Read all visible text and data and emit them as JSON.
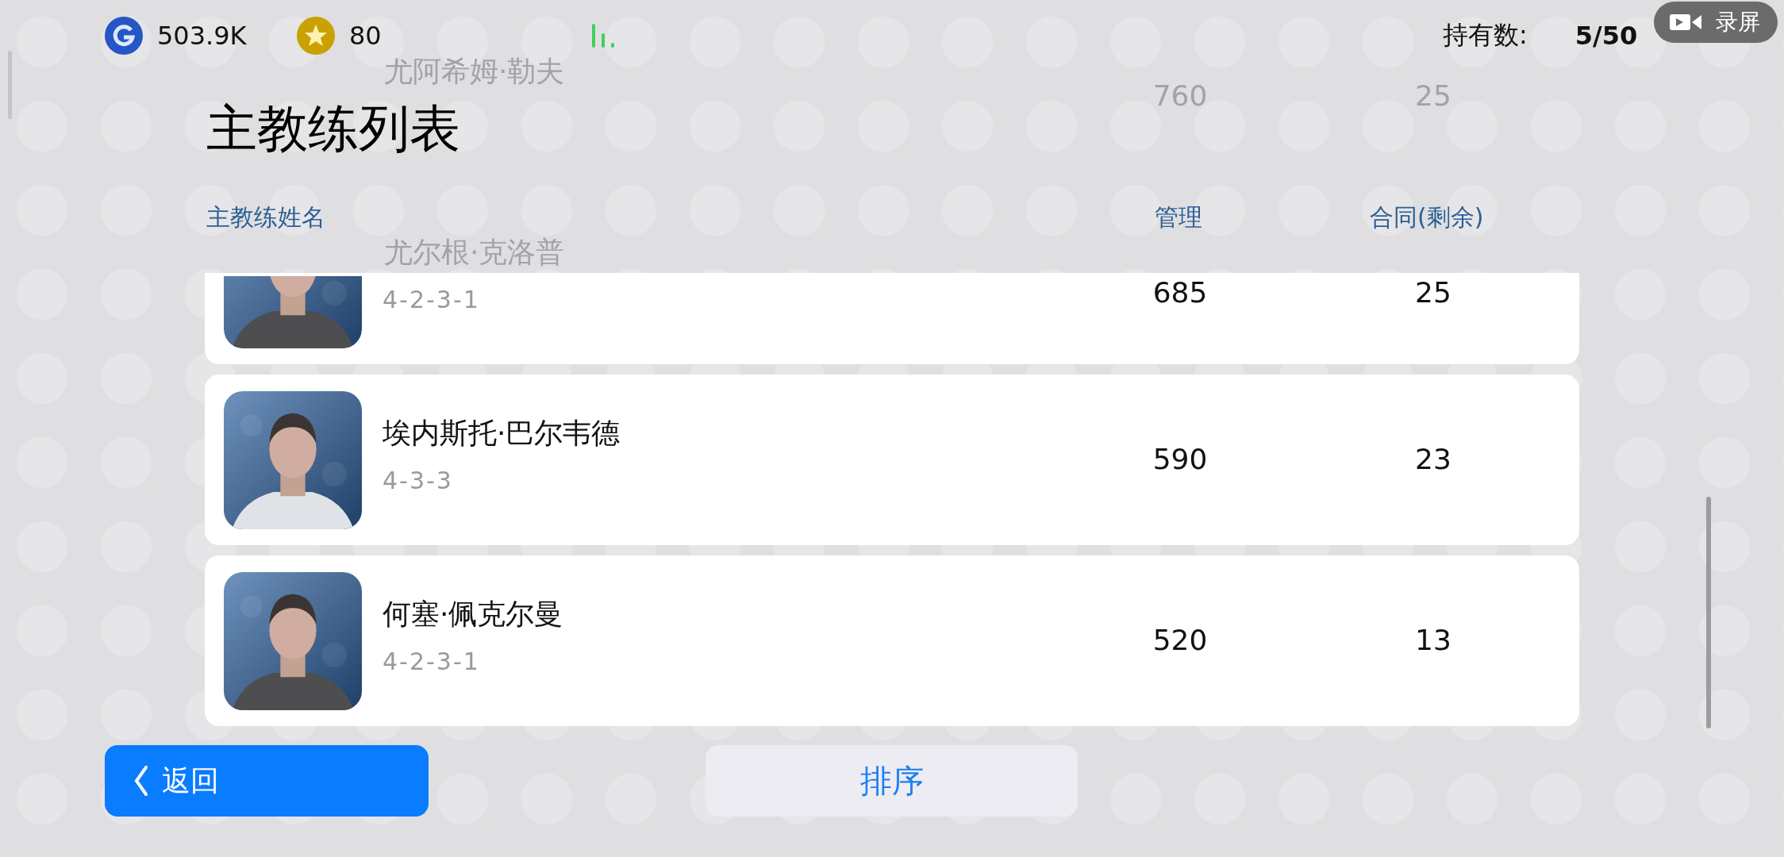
{
  "top_bar": {
    "coins": "503.9K",
    "stars": "80",
    "owned_label": "持有数:",
    "owned_value": "5/50"
  },
  "recorder": {
    "label": "录屏"
  },
  "title": "主教练列表",
  "columns": [
    "主教练姓名",
    "管理",
    "合同(剩余)"
  ],
  "coaches": [
    {
      "name": "尤阿希姆·勒夫",
      "management": "760",
      "contract": "25",
      "under_header": true,
      "top_cut": false
    },
    {
      "name": "尤尔根·克洛普",
      "formation": "4-2-3-1",
      "management": "685",
      "contract": "25",
      "under_header": false,
      "top_cut": true
    },
    {
      "name": "埃内斯托·巴尔韦德",
      "formation": "4-3-3",
      "management": "590",
      "contract": "23",
      "under_header": false,
      "top_cut": false
    },
    {
      "name": "何塞·佩克尔曼",
      "formation": "4-2-3-1",
      "management": "520",
      "contract": "13",
      "under_header": false,
      "top_cut": false
    }
  ],
  "buttons": {
    "back": "返回",
    "sort": "排序"
  }
}
